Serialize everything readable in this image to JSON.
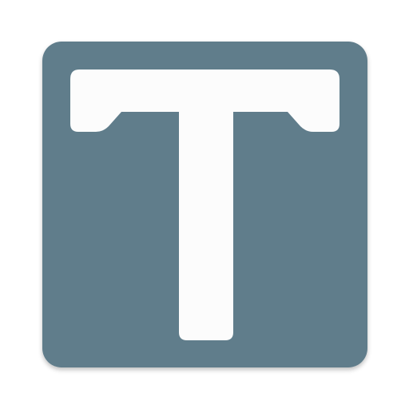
{
  "icon": {
    "name": "letter-t-app-icon",
    "colors": {
      "tile": "#607D8B",
      "glyph": "#FCFCFC",
      "shadow": "#C9CED2"
    }
  }
}
